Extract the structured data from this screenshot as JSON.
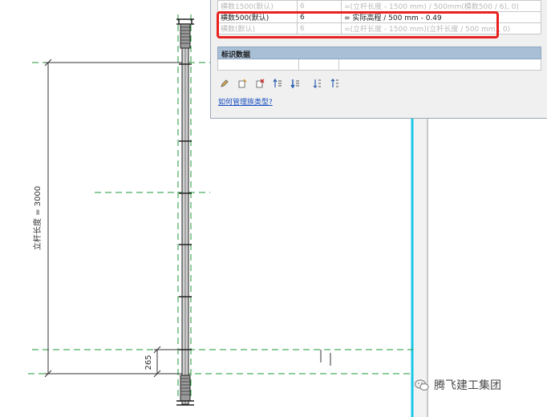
{
  "dimension": {
    "length_label": "立杆长度 = 3000",
    "small_label": "265"
  },
  "table": {
    "rows": [
      {
        "name": "横数1500(默认)",
        "value": "6",
        "formula": "=(立杆长度 - 1500 mm) / 500mm(模数500 / 6), 0)",
        "faded": true
      },
      {
        "name": "横数500(默认)",
        "value": "6",
        "formula": "= 实际高程 / 500 mm - 0.49",
        "faded": false
      },
      {
        "name": "横数(默认)",
        "value": "6",
        "formula": "=(立杆长度 - 1500 mm)(立杆长度 / 500 mm), 0)",
        "faded": true
      }
    ]
  },
  "section": {
    "header": "标识数据"
  },
  "toolbar": {
    "icons": [
      "pencil-icon",
      "new-param-icon",
      "delete-param-icon",
      "move-up-icon",
      "move-down-icon",
      "sort-ascending-icon",
      "sort-descending-icon"
    ]
  },
  "help": {
    "link_text": "如何管理族类型?"
  },
  "watermark": {
    "text": "腾飞建工集团"
  },
  "colors": {
    "dash_green": "#1f9a3a",
    "highlight_red": "#e8231f",
    "cyan_line": "#17c8e6",
    "link_blue": "#1a4fbf"
  }
}
